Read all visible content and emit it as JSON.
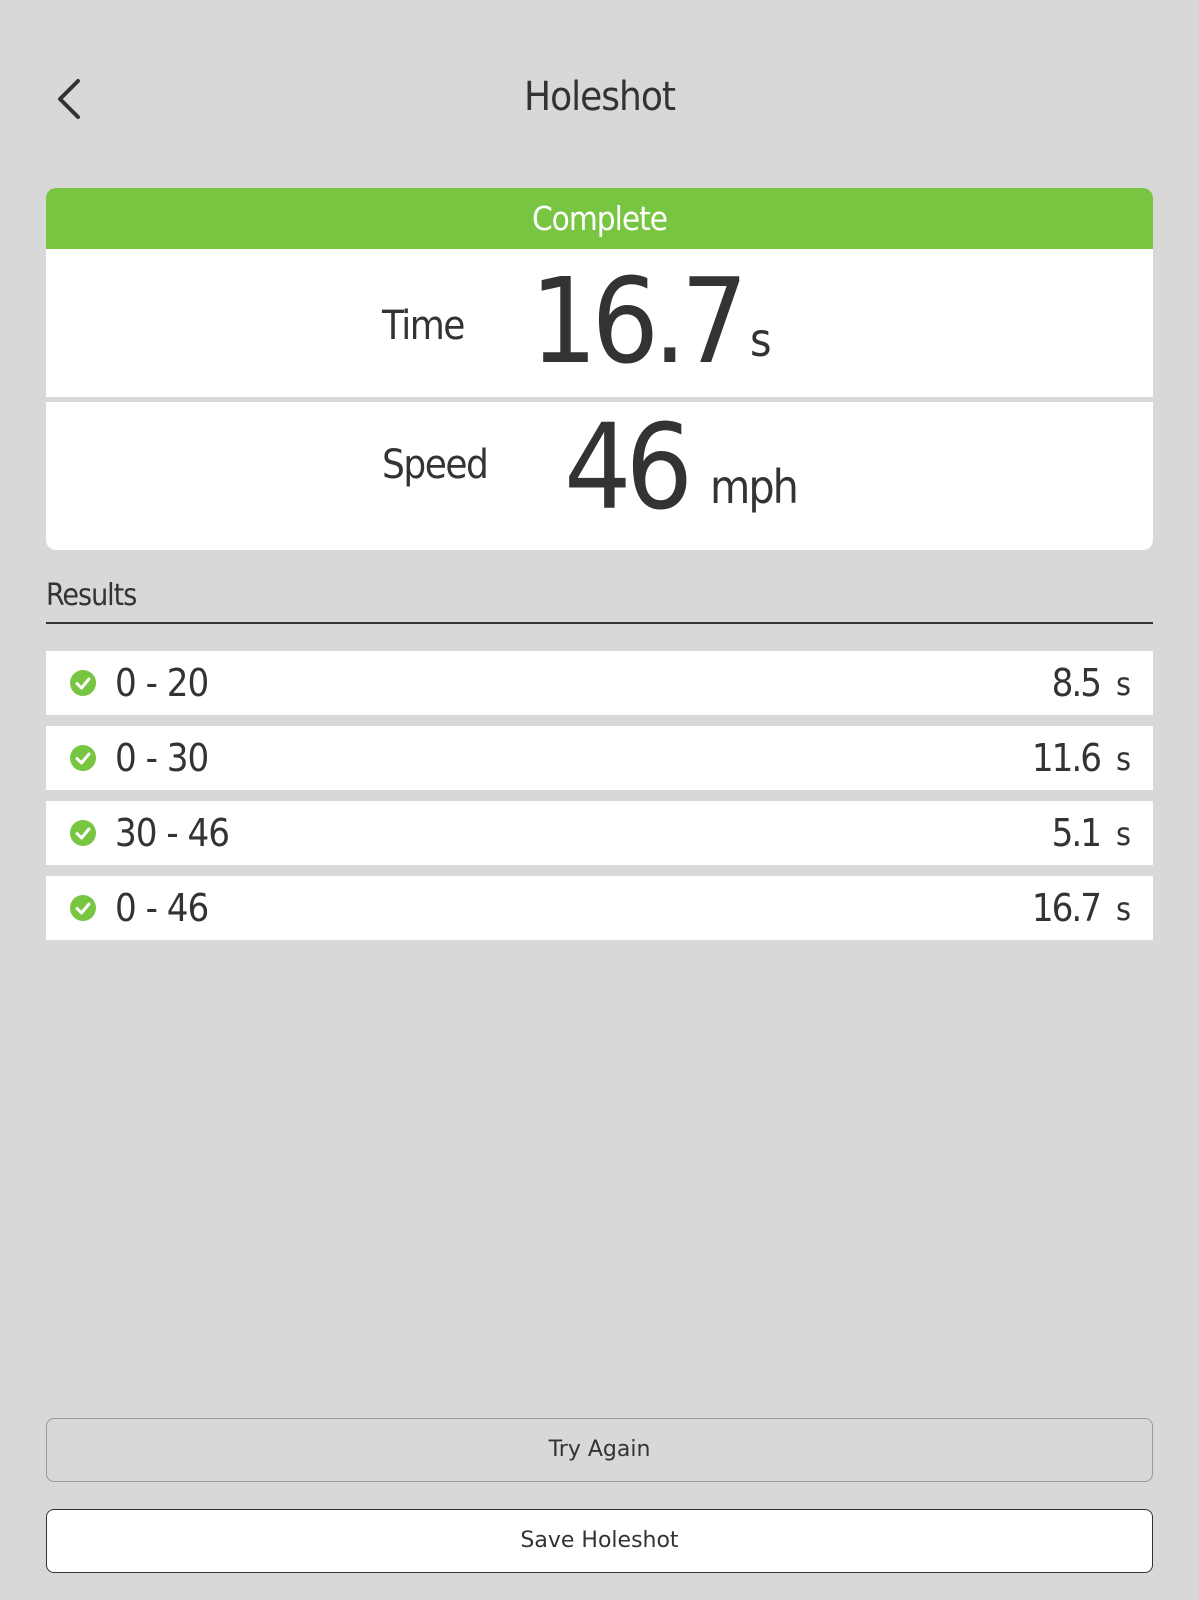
{
  "header": {
    "title": "Holeshot"
  },
  "summary": {
    "status": "Complete",
    "time": {
      "label": "Time",
      "value": "16.7",
      "unit": "s"
    },
    "speed": {
      "label": "Speed",
      "value": "46",
      "unit": "mph"
    }
  },
  "results": {
    "heading": "Results",
    "rows": [
      {
        "range": "0 - 20",
        "value": "8.5",
        "unit": "s"
      },
      {
        "range": "0 - 30",
        "value": "11.6",
        "unit": "s"
      },
      {
        "range": "30 - 46",
        "value": "5.1",
        "unit": "s"
      },
      {
        "range": "0 - 46",
        "value": "16.7",
        "unit": "s"
      }
    ]
  },
  "actions": {
    "try_again": "Try Again",
    "save": "Save Holeshot"
  },
  "colors": {
    "background": "#d8d8d8",
    "accent_green": "#78c542",
    "text": "#333333"
  },
  "icons": {
    "back": "chevron-left-icon",
    "row_status": "check-circle-icon"
  }
}
